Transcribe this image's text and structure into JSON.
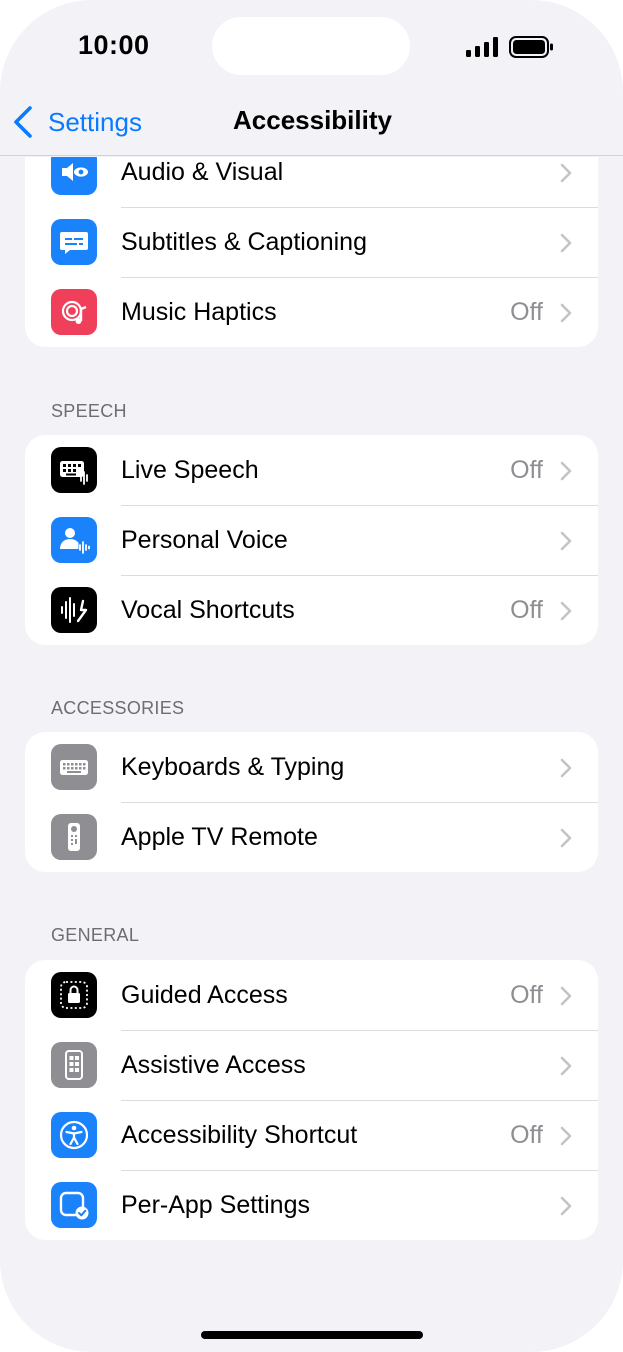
{
  "status_bar": {
    "time": "10:00"
  },
  "nav": {
    "back_label": "Settings",
    "title": "Accessibility"
  },
  "colors": {
    "accent": "#0a7aff",
    "blue": "#1a82fb",
    "red": "#ef3f5a",
    "black": "#000000",
    "gray": "#8e8e93"
  },
  "groups": {
    "hearing": {
      "items": [
        {
          "label": "Audio & Visual",
          "value": "",
          "icon": "speaker-eye-icon"
        },
        {
          "label": "Subtitles & Captioning",
          "value": "",
          "icon": "caption-bubble-icon"
        },
        {
          "label": "Music Haptics",
          "value": "Off",
          "icon": "music-haptics-icon"
        }
      ]
    },
    "speech": {
      "header": "SPEECH",
      "items": [
        {
          "label": "Live Speech",
          "value": "Off",
          "icon": "keyboard-wave-icon"
        },
        {
          "label": "Personal Voice",
          "value": "",
          "icon": "person-wave-icon"
        },
        {
          "label": "Vocal Shortcuts",
          "value": "Off",
          "icon": "waveform-arrow-icon"
        }
      ]
    },
    "accessories": {
      "header": "ACCESSORIES",
      "items": [
        {
          "label": "Keyboards & Typing",
          "value": "",
          "icon": "keyboard-icon"
        },
        {
          "label": "Apple TV Remote",
          "value": "",
          "icon": "remote-icon"
        }
      ]
    },
    "general": {
      "header": "GENERAL",
      "items": [
        {
          "label": "Guided Access",
          "value": "Off",
          "icon": "lock-dotted-icon"
        },
        {
          "label": "Assistive Access",
          "value": "",
          "icon": "assistive-access-icon"
        },
        {
          "label": "Accessibility Shortcut",
          "value": "Off",
          "icon": "accessibility-icon"
        },
        {
          "label": "Per-App Settings",
          "value": "",
          "icon": "app-check-icon"
        }
      ]
    }
  }
}
